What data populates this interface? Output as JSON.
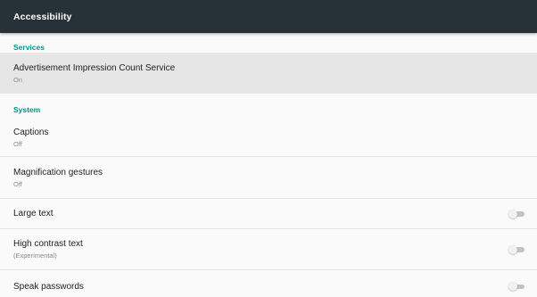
{
  "toolbar": {
    "title": "Accessibility"
  },
  "sections": {
    "services": {
      "header": "Services",
      "items": [
        {
          "title": "Advertisement Impression Count Service",
          "summary": "On"
        }
      ]
    },
    "system": {
      "header": "System",
      "items": [
        {
          "title": "Captions",
          "summary": "Off"
        },
        {
          "title": "Magnification gestures",
          "summary": "Off"
        },
        {
          "title": "Large text",
          "toggle": "off"
        },
        {
          "title": "High contrast text",
          "summary": "(Experimental)",
          "toggle": "off"
        },
        {
          "title": "Speak passwords",
          "toggle": "off"
        }
      ]
    }
  },
  "colors": {
    "toolbar_bg": "#263238",
    "accent": "#009688",
    "highlight_row": "#e6e6e6",
    "background": "#fafafa"
  }
}
